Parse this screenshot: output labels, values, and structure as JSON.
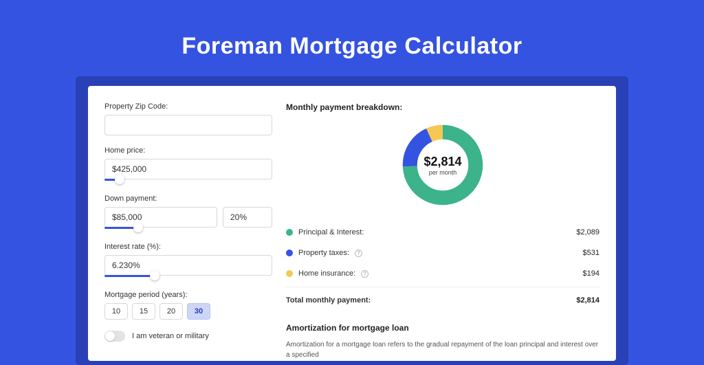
{
  "title": "Foreman Mortgage Calculator",
  "form": {
    "zip_label": "Property Zip Code:",
    "zip_value": "",
    "home_price_label": "Home price:",
    "home_price_value": "$425,000",
    "home_price_slider_pct": 9,
    "down_payment_label": "Down payment:",
    "down_payment_value": "$85,000",
    "down_payment_pct": "20%",
    "down_payment_slider_pct": 20,
    "interest_label": "Interest rate (%):",
    "interest_value": "6.230%",
    "interest_slider_pct": 30,
    "period_label": "Mortgage period (years):",
    "periods": [
      "10",
      "15",
      "20",
      "30"
    ],
    "period_selected": "30",
    "veteran_label": "I am veteran or military"
  },
  "breakdown": {
    "title": "Monthly payment breakdown:",
    "total_amount": "$2,814",
    "total_sub": "per month",
    "items": [
      {
        "label": "Principal & Interest:",
        "value": "$2,089",
        "color": "green",
        "info": false
      },
      {
        "label": "Property taxes:",
        "value": "$531",
        "color": "blue",
        "info": true
      },
      {
        "label": "Home insurance:",
        "value": "$194",
        "color": "yellow",
        "info": true
      }
    ],
    "total_row": {
      "label": "Total monthly payment:",
      "value": "$2,814"
    }
  },
  "amortization": {
    "title": "Amortization for mortgage loan",
    "text": "Amortization for a mortgage loan refers to the gradual repayment of the loan principal and interest over a specified"
  },
  "chart_data": {
    "type": "pie",
    "title": "Monthly payment breakdown",
    "series": [
      {
        "name": "Principal & Interest",
        "value": 2089,
        "color": "#3cb38a"
      },
      {
        "name": "Property taxes",
        "value": 531,
        "color": "#3453e0"
      },
      {
        "name": "Home insurance",
        "value": 194,
        "color": "#f6c756"
      }
    ],
    "total": 2814,
    "center_label": "$2,814",
    "center_sub": "per month"
  }
}
